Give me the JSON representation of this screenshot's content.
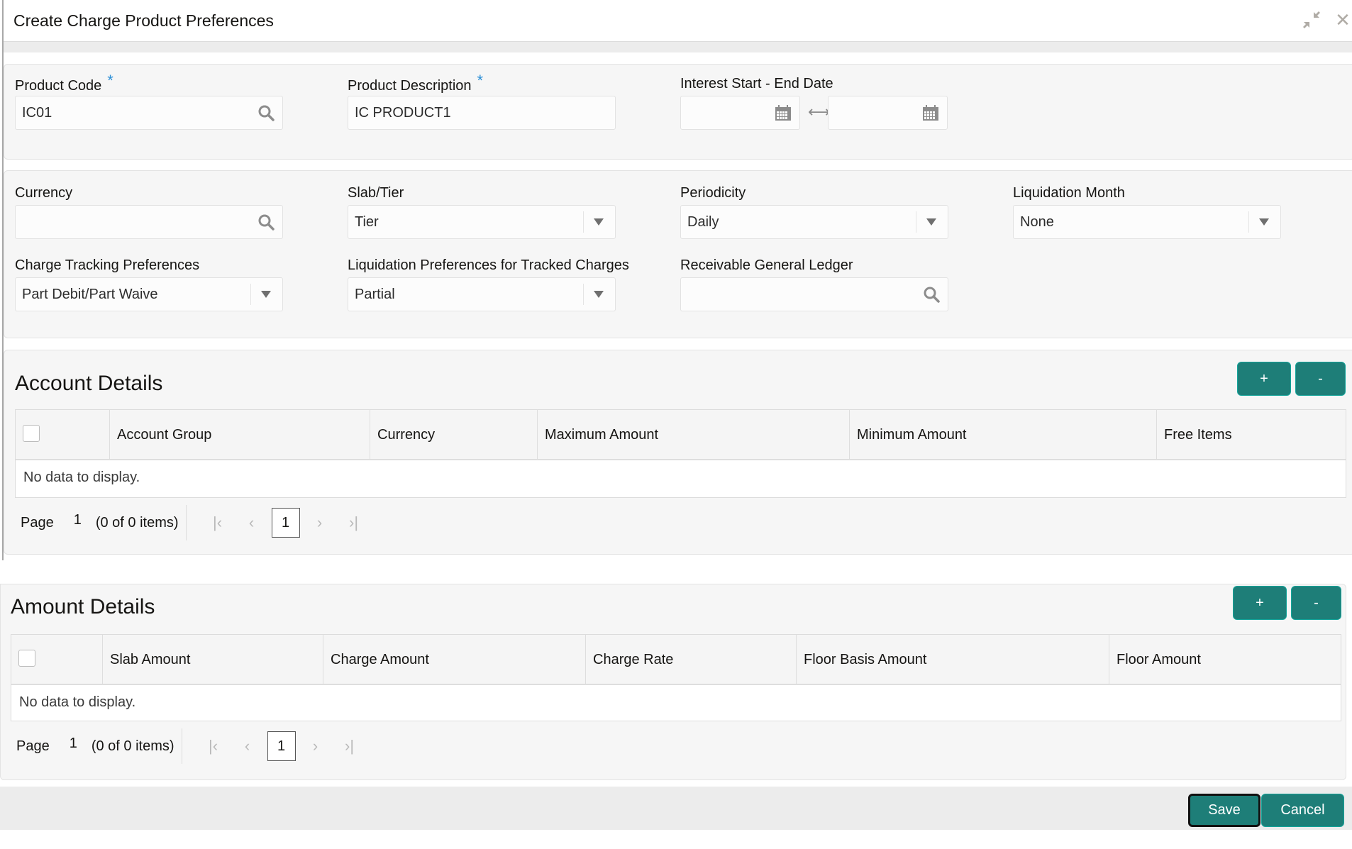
{
  "window": {
    "title": "Create Charge Product Preferences",
    "minimize_icon": "collapse-arrows-icon",
    "close_icon": "close-x-icon"
  },
  "product": {
    "code_label": "Product Code",
    "code_required": "*",
    "code_value": "IC01",
    "description_label": "Product Description",
    "description_required": "*",
    "description_value": "IC PRODUCT1",
    "interest_dates_label": "Interest Start - End Date",
    "start_date_value": "",
    "end_date_value": "",
    "date_separator": "⟷"
  },
  "preferences": {
    "currency_label": "Currency",
    "currency_value": "",
    "slab_tier_label": "Slab/Tier",
    "slab_tier_value": "Tier",
    "periodicity_label": "Periodicity",
    "periodicity_value": "Daily",
    "liquidation_month_label": "Liquidation Month",
    "liquidation_month_value": "None",
    "charge_tracking_label": "Charge Tracking Preferences",
    "charge_tracking_value": "Part Debit/Part Waive",
    "liq_pref_tracked_label": "Liquidation Preferences for Tracked Charges",
    "liq_pref_tracked_value": "Partial",
    "receivable_gl_label": "Receivable General Ledger",
    "receivable_gl_value": ""
  },
  "account_details": {
    "title": "Account Details",
    "add_label": "+",
    "remove_label": "-",
    "columns": [
      "Account Group",
      "Currency",
      "Maximum Amount",
      "Minimum Amount",
      "Free Items"
    ],
    "rows": [],
    "empty_text": "No data to display.",
    "pager": {
      "page_label": "Page",
      "page_number": "1",
      "count_text": "(0 of 0 items)",
      "current_page": "1",
      "first": "K",
      "prev": "‹",
      "next": "›",
      "last": "K"
    }
  },
  "amount_details": {
    "title": "Amount Details",
    "add_label": "+",
    "remove_label": "-",
    "columns": [
      "Slab Amount",
      "Charge Amount",
      "Charge Rate",
      "Floor Basis Amount",
      "Floor Amount"
    ],
    "rows": [],
    "empty_text": "No data to display.",
    "pager": {
      "page_label": "Page",
      "page_number": "1",
      "count_text": "(0 of 0 items)",
      "current_page": "1",
      "first": "K",
      "prev": "‹",
      "next": "›",
      "last": "K"
    }
  },
  "footer": {
    "save_label": "Save",
    "cancel_label": "Cancel"
  },
  "colors": {
    "accent": "#1e7e78",
    "required": "#2b8fd6",
    "panel_bg": "#f6f6f6"
  }
}
